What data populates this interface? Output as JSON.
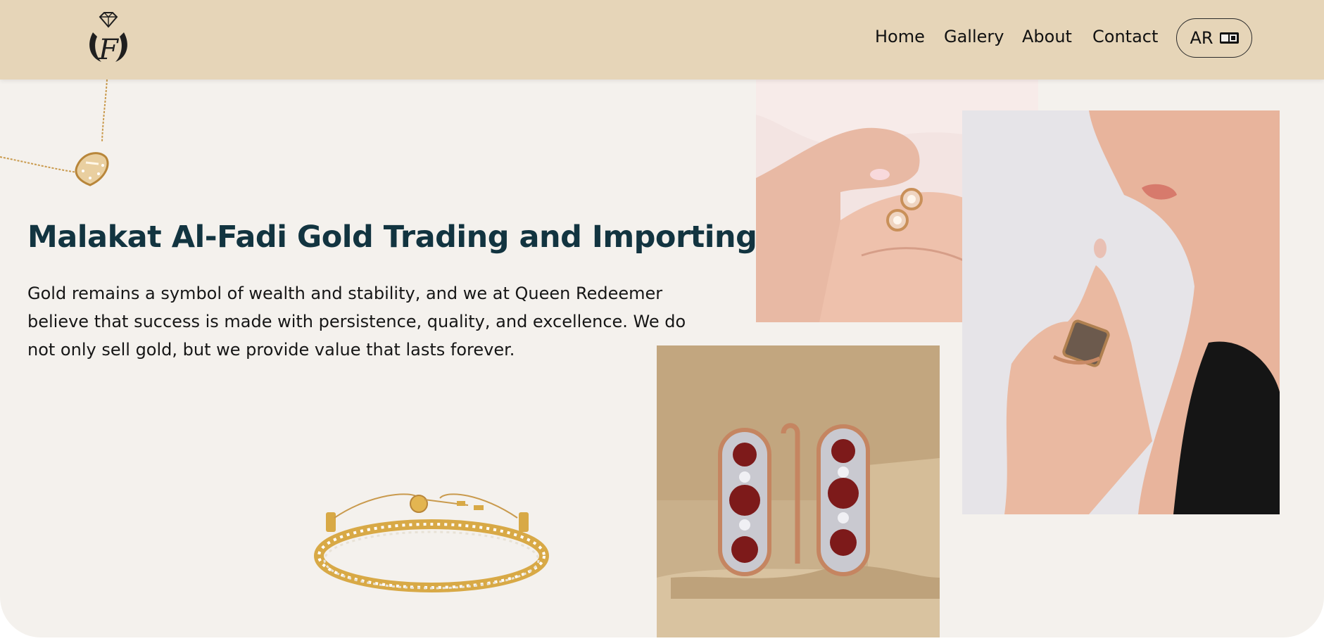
{
  "brand": {
    "logo_icon": "diamond-crown-f-logo-icon"
  },
  "nav": {
    "items": [
      "Home",
      "Gallery",
      "About",
      "Contact"
    ],
    "language_label": "AR",
    "language_icon": "translate-icon"
  },
  "hero": {
    "title": "Malakat Al-Fadi Gold Trading and Importing",
    "description": "Gold remains a symbol of wealth and stability, and we at Queen Redeemer believe that success is made with persistence, quality, and excellence. We do not only sell gold, but we provide value that lasts forever."
  },
  "images": {
    "hands": "hands-holding-earrings-photo",
    "woman": "woman-wearing-ring-photo",
    "earrings": "ruby-diamond-earrings-photo",
    "necklace": "gold-heart-necklace-image",
    "bracelet": "diamond-tennis-bracelet-image"
  },
  "colors": {
    "header_bg": "#e6d5b8",
    "hero_bg": "#f4f1ed",
    "title": "#123440",
    "gold": "#d4a24c"
  }
}
